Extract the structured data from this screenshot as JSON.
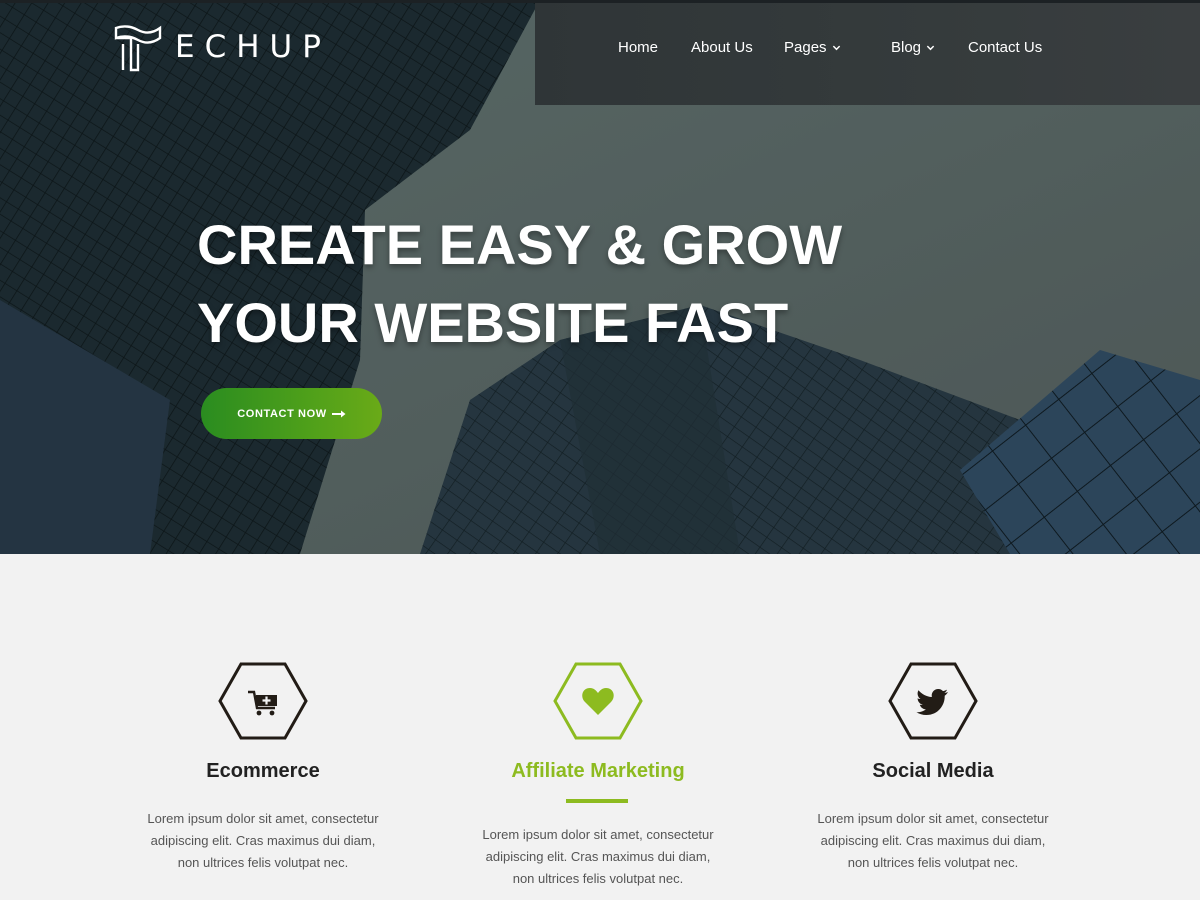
{
  "brand": {
    "name": "ECHUP",
    "logo_icon": "techup-t-logo-icon"
  },
  "nav": {
    "items": [
      {
        "label": "Home",
        "has_dropdown": false
      },
      {
        "label": "About Us",
        "has_dropdown": false
      },
      {
        "label": "Pages",
        "has_dropdown": true
      },
      {
        "label": "Blog",
        "has_dropdown": true
      },
      {
        "label": "Contact Us",
        "has_dropdown": false
      }
    ]
  },
  "hero": {
    "headline_line1": "CREATE EASY & GROW",
    "headline_line2": "YOUR WEBSITE FAST",
    "cta_label": "CONTACT NOW",
    "cta_icon": "arrow-right-icon",
    "cta_color": "#3f961c"
  },
  "features": {
    "accent_color": "#8dbb20",
    "items": [
      {
        "icon": "cart-plus-icon",
        "title": "Ecommerce",
        "description": "Lorem ipsum dolor sit amet, consectetur adipiscing elit. Cras maximus dui diam, non ultrices felis volutpat nec.",
        "active": false
      },
      {
        "icon": "heart-icon",
        "title": "Affiliate Marketing",
        "description": "Lorem ipsum dolor sit amet, consectetur adipiscing elit. Cras maximus dui diam, non ultrices felis volutpat nec.",
        "active": true
      },
      {
        "icon": "twitter-bird-icon",
        "title": "Social Media",
        "description": "Lorem ipsum dolor sit amet, consectetur adipiscing elit. Cras maximus dui diam, non ultrices felis volutpat nec.",
        "active": false
      }
    ]
  }
}
